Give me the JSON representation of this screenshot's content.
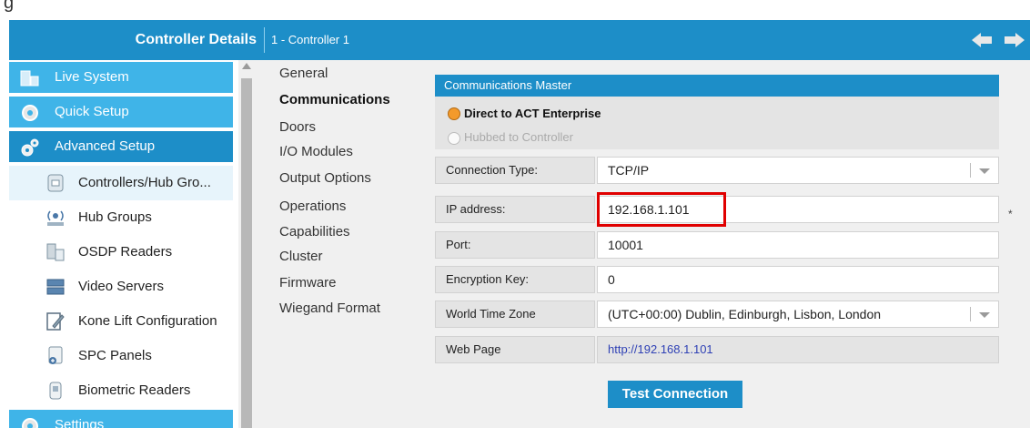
{
  "window": {
    "top_fragment": "g"
  },
  "header": {
    "title": "Controller Details",
    "controller": "1 - Controller 1"
  },
  "sidebar": {
    "sections": {
      "live": "Live System",
      "quick": "Quick Setup",
      "advanced": "Advanced Setup",
      "settings": "Settings"
    },
    "items": [
      {
        "label": "Controllers/Hub Gro..."
      },
      {
        "label": "Hub Groups"
      },
      {
        "label": "OSDP Readers"
      },
      {
        "label": "Video Servers"
      },
      {
        "label": "Kone Lift Configuration"
      },
      {
        "label": "SPC Panels"
      },
      {
        "label": "Biometric Readers"
      }
    ]
  },
  "subnav": [
    "General",
    "Communications",
    "Doors",
    "I/O Modules",
    "Output Options",
    "Operations",
    "Capabilities",
    "Cluster",
    "Firmware",
    "Wiegand Format"
  ],
  "comms": {
    "section_title": "Communications Master",
    "radio_direct": "Direct to ACT Enterprise",
    "radio_hubbed": "Hubbed to Controller",
    "fields": [
      {
        "label": "Connection Type:",
        "value": "TCP/IP"
      },
      {
        "label": "IP address:",
        "value": "192.168.1.101"
      },
      {
        "label": "Port:",
        "value": "10001"
      },
      {
        "label": "Encryption Key:",
        "value": "0"
      },
      {
        "label": "World Time Zone",
        "value": "(UTC+00:00) Dublin, Edinburgh, Lisbon, London"
      },
      {
        "label": "Web Page",
        "value": "http://192.168.1.101"
      }
    ],
    "required_mark": "*",
    "test_button": "Test Connection"
  },
  "colors": {
    "header": "#1d8ec8",
    "section": "#3fb4e8",
    "radio_selected": "#f39a2b",
    "highlight": "#e00000",
    "link": "#2f41b5"
  }
}
